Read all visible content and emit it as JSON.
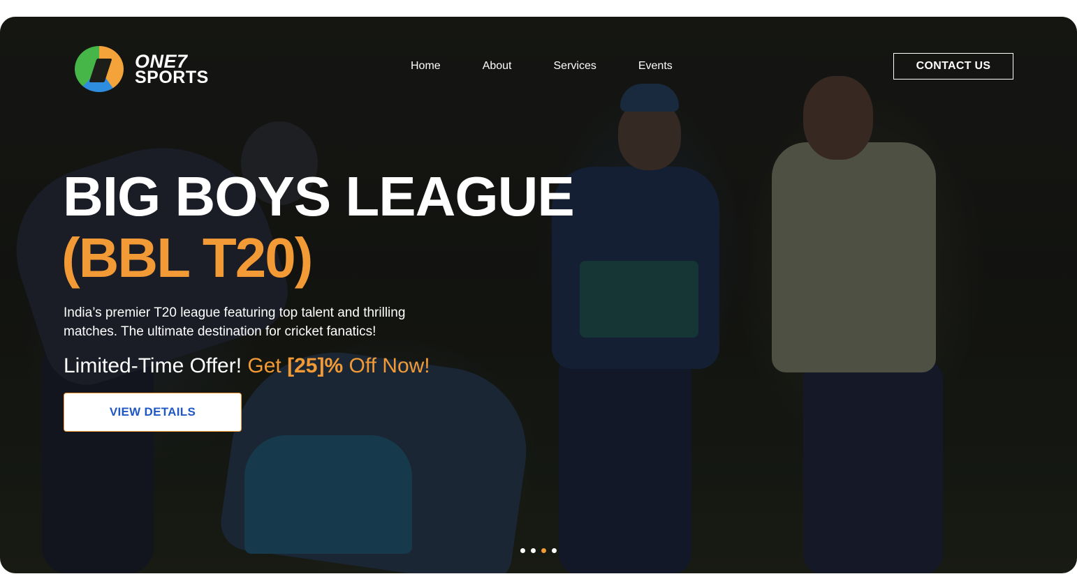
{
  "brand": {
    "line1": "ONE7",
    "line2": "SPORTS"
  },
  "nav": {
    "items": [
      {
        "label": "Home"
      },
      {
        "label": "About"
      },
      {
        "label": "Services"
      },
      {
        "label": "Events"
      }
    ],
    "contact_label": "CONTACT US"
  },
  "hero": {
    "title": "BIG BOYS LEAGUE",
    "subtitle": "(BBL T20)",
    "description": "India’s premier T20 league featuring top talent and thrilling matches. The ultimate destination for cricket fanatics!",
    "offer": {
      "lead": "Limited-Time Offer!",
      "get": "Get",
      "amount": "[25]%",
      "tail": "Off Now!"
    },
    "cta_label": "VIEW DETAILS"
  },
  "carousel": {
    "total": 4,
    "active_index": 2
  },
  "colors": {
    "accent": "#f29a35",
    "cta_text": "#1f57c4",
    "text": "#ffffff"
  }
}
